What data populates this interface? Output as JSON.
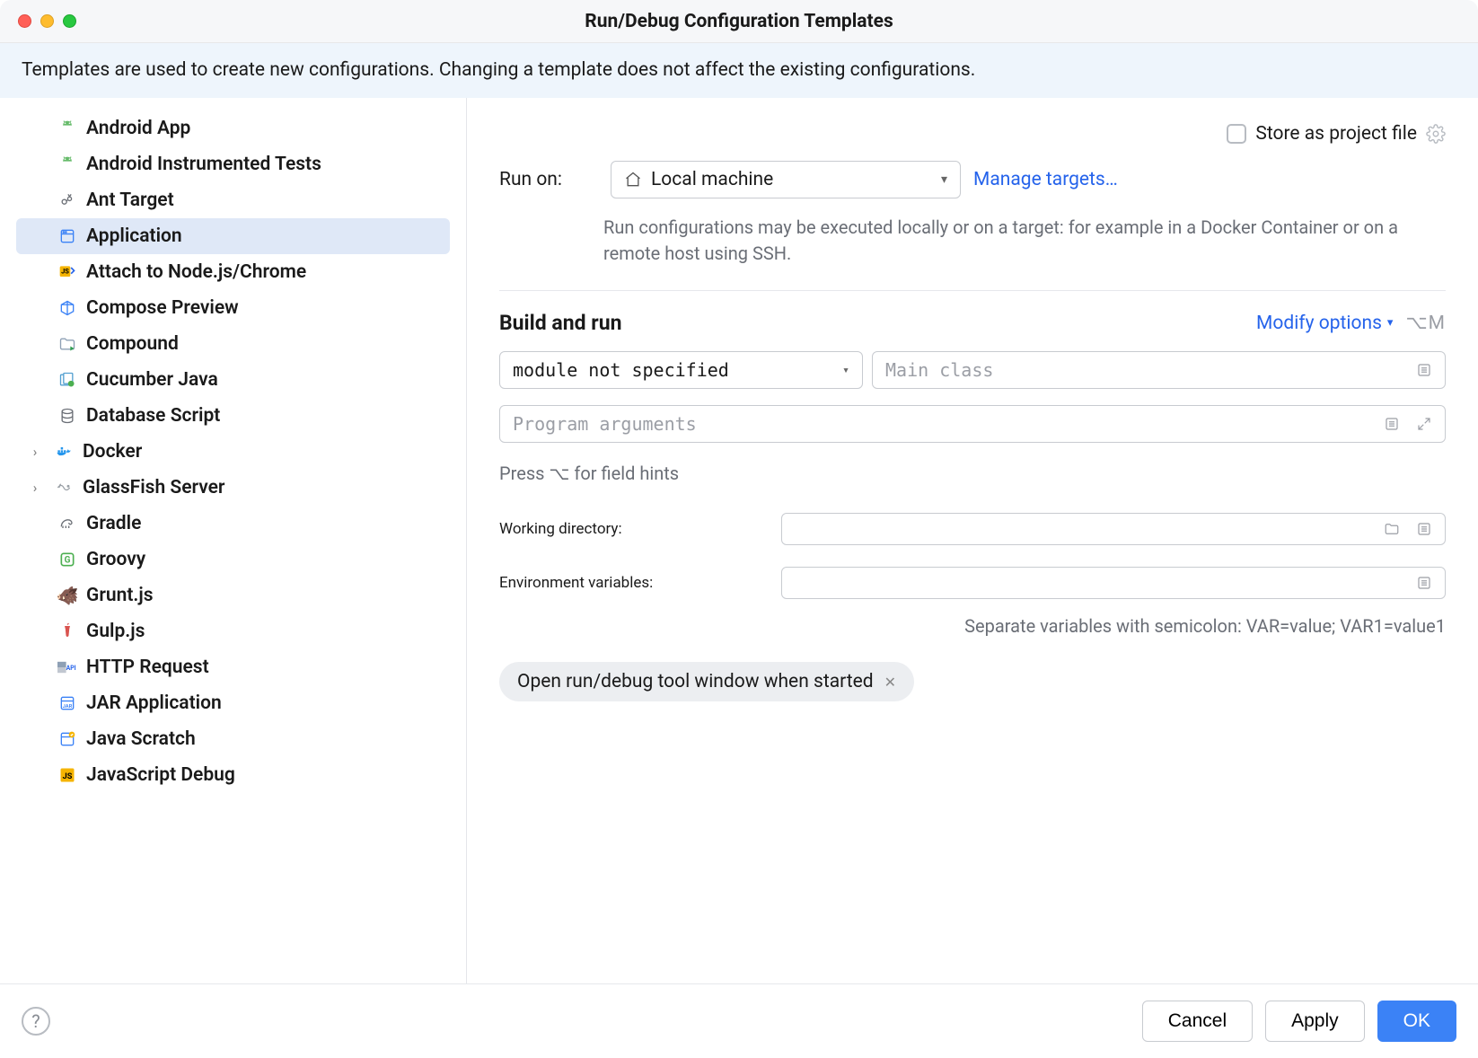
{
  "window": {
    "title": "Run/Debug Configuration Templates"
  },
  "banner": "Templates are used to create new configurations. Changing a template does not affect the existing configurations.",
  "sidebar": {
    "items": [
      {
        "label": "Android App",
        "icon": "android",
        "color": "#66bb6a"
      },
      {
        "label": "Android Instrumented Tests",
        "icon": "android",
        "color": "#66bb6a"
      },
      {
        "label": "Ant Target",
        "icon": "ant",
        "color": "#6b6f76"
      },
      {
        "label": "Application",
        "icon": "app",
        "color": "#3b82f6",
        "selected": true
      },
      {
        "label": "Attach to Node.js/Chrome",
        "icon": "js-attach",
        "color": "#f5b400"
      },
      {
        "label": "Compose Preview",
        "icon": "compose",
        "color": "#3b82f6"
      },
      {
        "label": "Compound",
        "icon": "compound",
        "color": "#8ea0b5"
      },
      {
        "label": "Cucumber Java",
        "icon": "cucumber",
        "color": "#54a0d0"
      },
      {
        "label": "Database Script",
        "icon": "db",
        "color": "#6b6f76"
      },
      {
        "label": "Docker",
        "icon": "docker",
        "color": "#2496ed",
        "hasChildren": true
      },
      {
        "label": "GlassFish Server",
        "icon": "glassfish",
        "color": "#9aa0a6",
        "hasChildren": true
      },
      {
        "label": "Gradle",
        "icon": "gradle",
        "color": "#6b6f76"
      },
      {
        "label": "Groovy",
        "icon": "groovy",
        "color": "#4caf50"
      },
      {
        "label": "Grunt.js",
        "icon": "grunt",
        "color": "#d68a3a"
      },
      {
        "label": "Gulp.js",
        "icon": "gulp",
        "color": "#d9534f"
      },
      {
        "label": "HTTP Request",
        "icon": "http",
        "color": "#3b82f6"
      },
      {
        "label": "JAR Application",
        "icon": "jar",
        "color": "#3b82f6"
      },
      {
        "label": "Java Scratch",
        "icon": "scratch",
        "color": "#3b82f6"
      },
      {
        "label": "JavaScript Debug",
        "icon": "js",
        "color": "#f5b400"
      }
    ]
  },
  "main": {
    "storeLabel": "Store as project file",
    "runOnLabel": "Run on:",
    "runOnValue": "Local machine",
    "manageTargets": "Manage targets…",
    "runOnHint": "Run configurations may be executed locally or on a target: for example in a Docker Container or on a remote host using SSH.",
    "buildRunTitle": "Build and run",
    "modifyOptions": "Modify options",
    "modifyShortcut": "⌥M",
    "moduleValue": "module not specified",
    "mainClassPh": "Main class",
    "programArgsPh": "Program arguments",
    "fieldHints": "Press ⌥ for field hints",
    "workingDirLabel": "Working directory:",
    "envVarsLabel": "Environment variables:",
    "envVarsHint": "Separate variables with semicolon: VAR=value; VAR1=value1",
    "pill": "Open run/debug tool window when started"
  },
  "footer": {
    "cancel": "Cancel",
    "apply": "Apply",
    "ok": "OK"
  }
}
